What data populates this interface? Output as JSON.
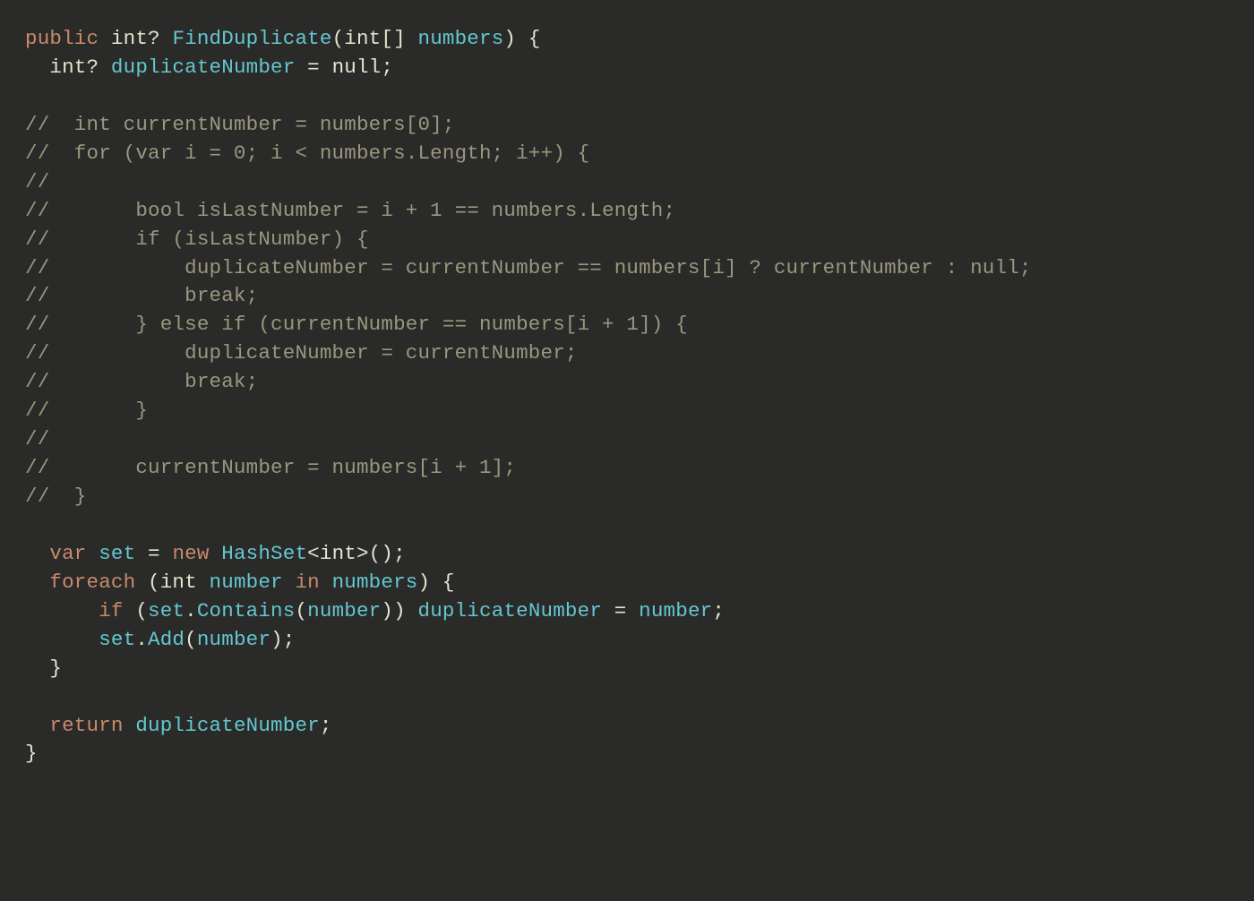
{
  "colors": {
    "background": "#2a2a28",
    "foreground": "#e6e3d0",
    "keyword": "#c88a6b",
    "identifier": "#64c7d0",
    "comment": "#9a977f"
  },
  "language": "C#",
  "code": {
    "tokens": [
      [
        [
          "kw",
          "public"
        ],
        [
          "punct",
          " "
        ],
        [
          "type",
          "int?"
        ],
        [
          "punct",
          " "
        ],
        [
          "func",
          "FindDuplicate"
        ],
        [
          "punct",
          "("
        ],
        [
          "type",
          "int[]"
        ],
        [
          "punct",
          " "
        ],
        [
          "param",
          "numbers"
        ],
        [
          "punct",
          ") {"
        ]
      ],
      [
        [
          "punct",
          "  "
        ],
        [
          "type",
          "int?"
        ],
        [
          "punct",
          " "
        ],
        [
          "ident",
          "duplicateNumber"
        ],
        [
          "punct",
          " "
        ],
        [
          "op",
          "="
        ],
        [
          "punct",
          " "
        ],
        [
          "lit",
          "null"
        ],
        [
          "punct",
          ";"
        ]
      ],
      [],
      [
        [
          "comment",
          "//  int currentNumber = numbers[0];"
        ]
      ],
      [
        [
          "comment",
          "//  for (var i = 0; i < numbers.Length; i++) {"
        ]
      ],
      [
        [
          "comment",
          "//"
        ]
      ],
      [
        [
          "comment",
          "//       bool isLastNumber = i + 1 == numbers.Length;"
        ]
      ],
      [
        [
          "comment",
          "//       if (isLastNumber) {"
        ]
      ],
      [
        [
          "comment",
          "//           duplicateNumber = currentNumber == numbers[i] ? currentNumber : null;"
        ]
      ],
      [
        [
          "comment",
          "//           break;"
        ]
      ],
      [
        [
          "comment",
          "//       } else if (currentNumber == numbers[i + 1]) {"
        ]
      ],
      [
        [
          "comment",
          "//           duplicateNumber = currentNumber;"
        ]
      ],
      [
        [
          "comment",
          "//           break;"
        ]
      ],
      [
        [
          "comment",
          "//       }"
        ]
      ],
      [
        [
          "comment",
          "//"
        ]
      ],
      [
        [
          "comment",
          "//       currentNumber = numbers[i + 1];"
        ]
      ],
      [
        [
          "comment",
          "//  }"
        ]
      ],
      [],
      [
        [
          "punct",
          "  "
        ],
        [
          "kw",
          "var"
        ],
        [
          "punct",
          " "
        ],
        [
          "ident",
          "set"
        ],
        [
          "punct",
          " "
        ],
        [
          "op",
          "="
        ],
        [
          "punct",
          " "
        ],
        [
          "kw",
          "new"
        ],
        [
          "punct",
          " "
        ],
        [
          "func",
          "HashSet"
        ],
        [
          "punct",
          "<"
        ],
        [
          "type",
          "int"
        ],
        [
          "punct",
          ">();"
        ]
      ],
      [
        [
          "punct",
          "  "
        ],
        [
          "kw",
          "foreach"
        ],
        [
          "punct",
          " ("
        ],
        [
          "type",
          "int"
        ],
        [
          "punct",
          " "
        ],
        [
          "ident",
          "number"
        ],
        [
          "punct",
          " "
        ],
        [
          "kw",
          "in"
        ],
        [
          "punct",
          " "
        ],
        [
          "ident",
          "numbers"
        ],
        [
          "punct",
          ") {"
        ]
      ],
      [
        [
          "punct",
          "      "
        ],
        [
          "kw",
          "if"
        ],
        [
          "punct",
          " ("
        ],
        [
          "ident",
          "set"
        ],
        [
          "punct",
          "."
        ],
        [
          "func",
          "Contains"
        ],
        [
          "punct",
          "("
        ],
        [
          "ident",
          "number"
        ],
        [
          "punct",
          ")) "
        ],
        [
          "ident",
          "duplicateNumber"
        ],
        [
          "punct",
          " "
        ],
        [
          "op",
          "="
        ],
        [
          "punct",
          " "
        ],
        [
          "ident",
          "number"
        ],
        [
          "punct",
          ";"
        ]
      ],
      [
        [
          "punct",
          "      "
        ],
        [
          "ident",
          "set"
        ],
        [
          "punct",
          "."
        ],
        [
          "func",
          "Add"
        ],
        [
          "punct",
          "("
        ],
        [
          "ident",
          "number"
        ],
        [
          "punct",
          ");"
        ]
      ],
      [
        [
          "punct",
          "  }"
        ]
      ],
      [],
      [
        [
          "punct",
          "  "
        ],
        [
          "kw",
          "return"
        ],
        [
          "punct",
          " "
        ],
        [
          "ident",
          "duplicateNumber"
        ],
        [
          "punct",
          ";"
        ]
      ],
      [
        [
          "punct",
          "}"
        ]
      ]
    ]
  }
}
